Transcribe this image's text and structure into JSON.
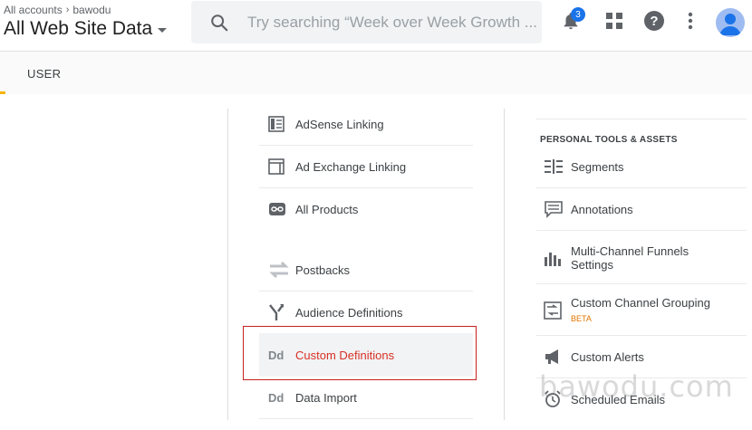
{
  "header": {
    "breadcrumb": [
      "All accounts",
      "bawodu"
    ],
    "property_name": "All Web Site Data",
    "search_placeholder": "Try searching “Week over Week Growth ...",
    "notification_count": "3"
  },
  "tabs": {
    "active": "USER"
  },
  "middle_column": {
    "items": [
      {
        "label": "AdSense Linking",
        "icon": "adsense-icon"
      },
      {
        "label": "Ad Exchange Linking",
        "icon": "ad-exchange-icon"
      },
      {
        "label": "All Products",
        "icon": "link-icon"
      },
      {
        "label": "Postbacks",
        "icon": "postbacks-icon"
      },
      {
        "label": "Audience Definitions",
        "icon": "audience-icon"
      },
      {
        "label": "Custom Definitions",
        "icon": "dd-icon",
        "selected": true,
        "selected_color": "#d93025"
      },
      {
        "label": "Data Import",
        "icon": "dd-icon"
      }
    ]
  },
  "right_column": {
    "section_title": "PERSONAL TOOLS & ASSETS",
    "items": [
      {
        "label": "Segments",
        "icon": "segments-icon"
      },
      {
        "label": "Annotations",
        "icon": "annotations-icon"
      },
      {
        "label": "Multi-Channel Funnels",
        "label2": "Settings",
        "icon": "bar-chart-icon"
      },
      {
        "label": "Custom Channel Grouping",
        "badge": "BETA",
        "icon": "channel-grouping-icon"
      },
      {
        "label": "Custom Alerts",
        "icon": "megaphone-icon"
      },
      {
        "label": "Scheduled Emails",
        "icon": "alarm-icon"
      }
    ]
  },
  "watermark": "bawodu.com",
  "colors": {
    "accent_blue": "#1a73e8",
    "selected_red": "#d93025",
    "tab_accent": "#f4b400"
  }
}
